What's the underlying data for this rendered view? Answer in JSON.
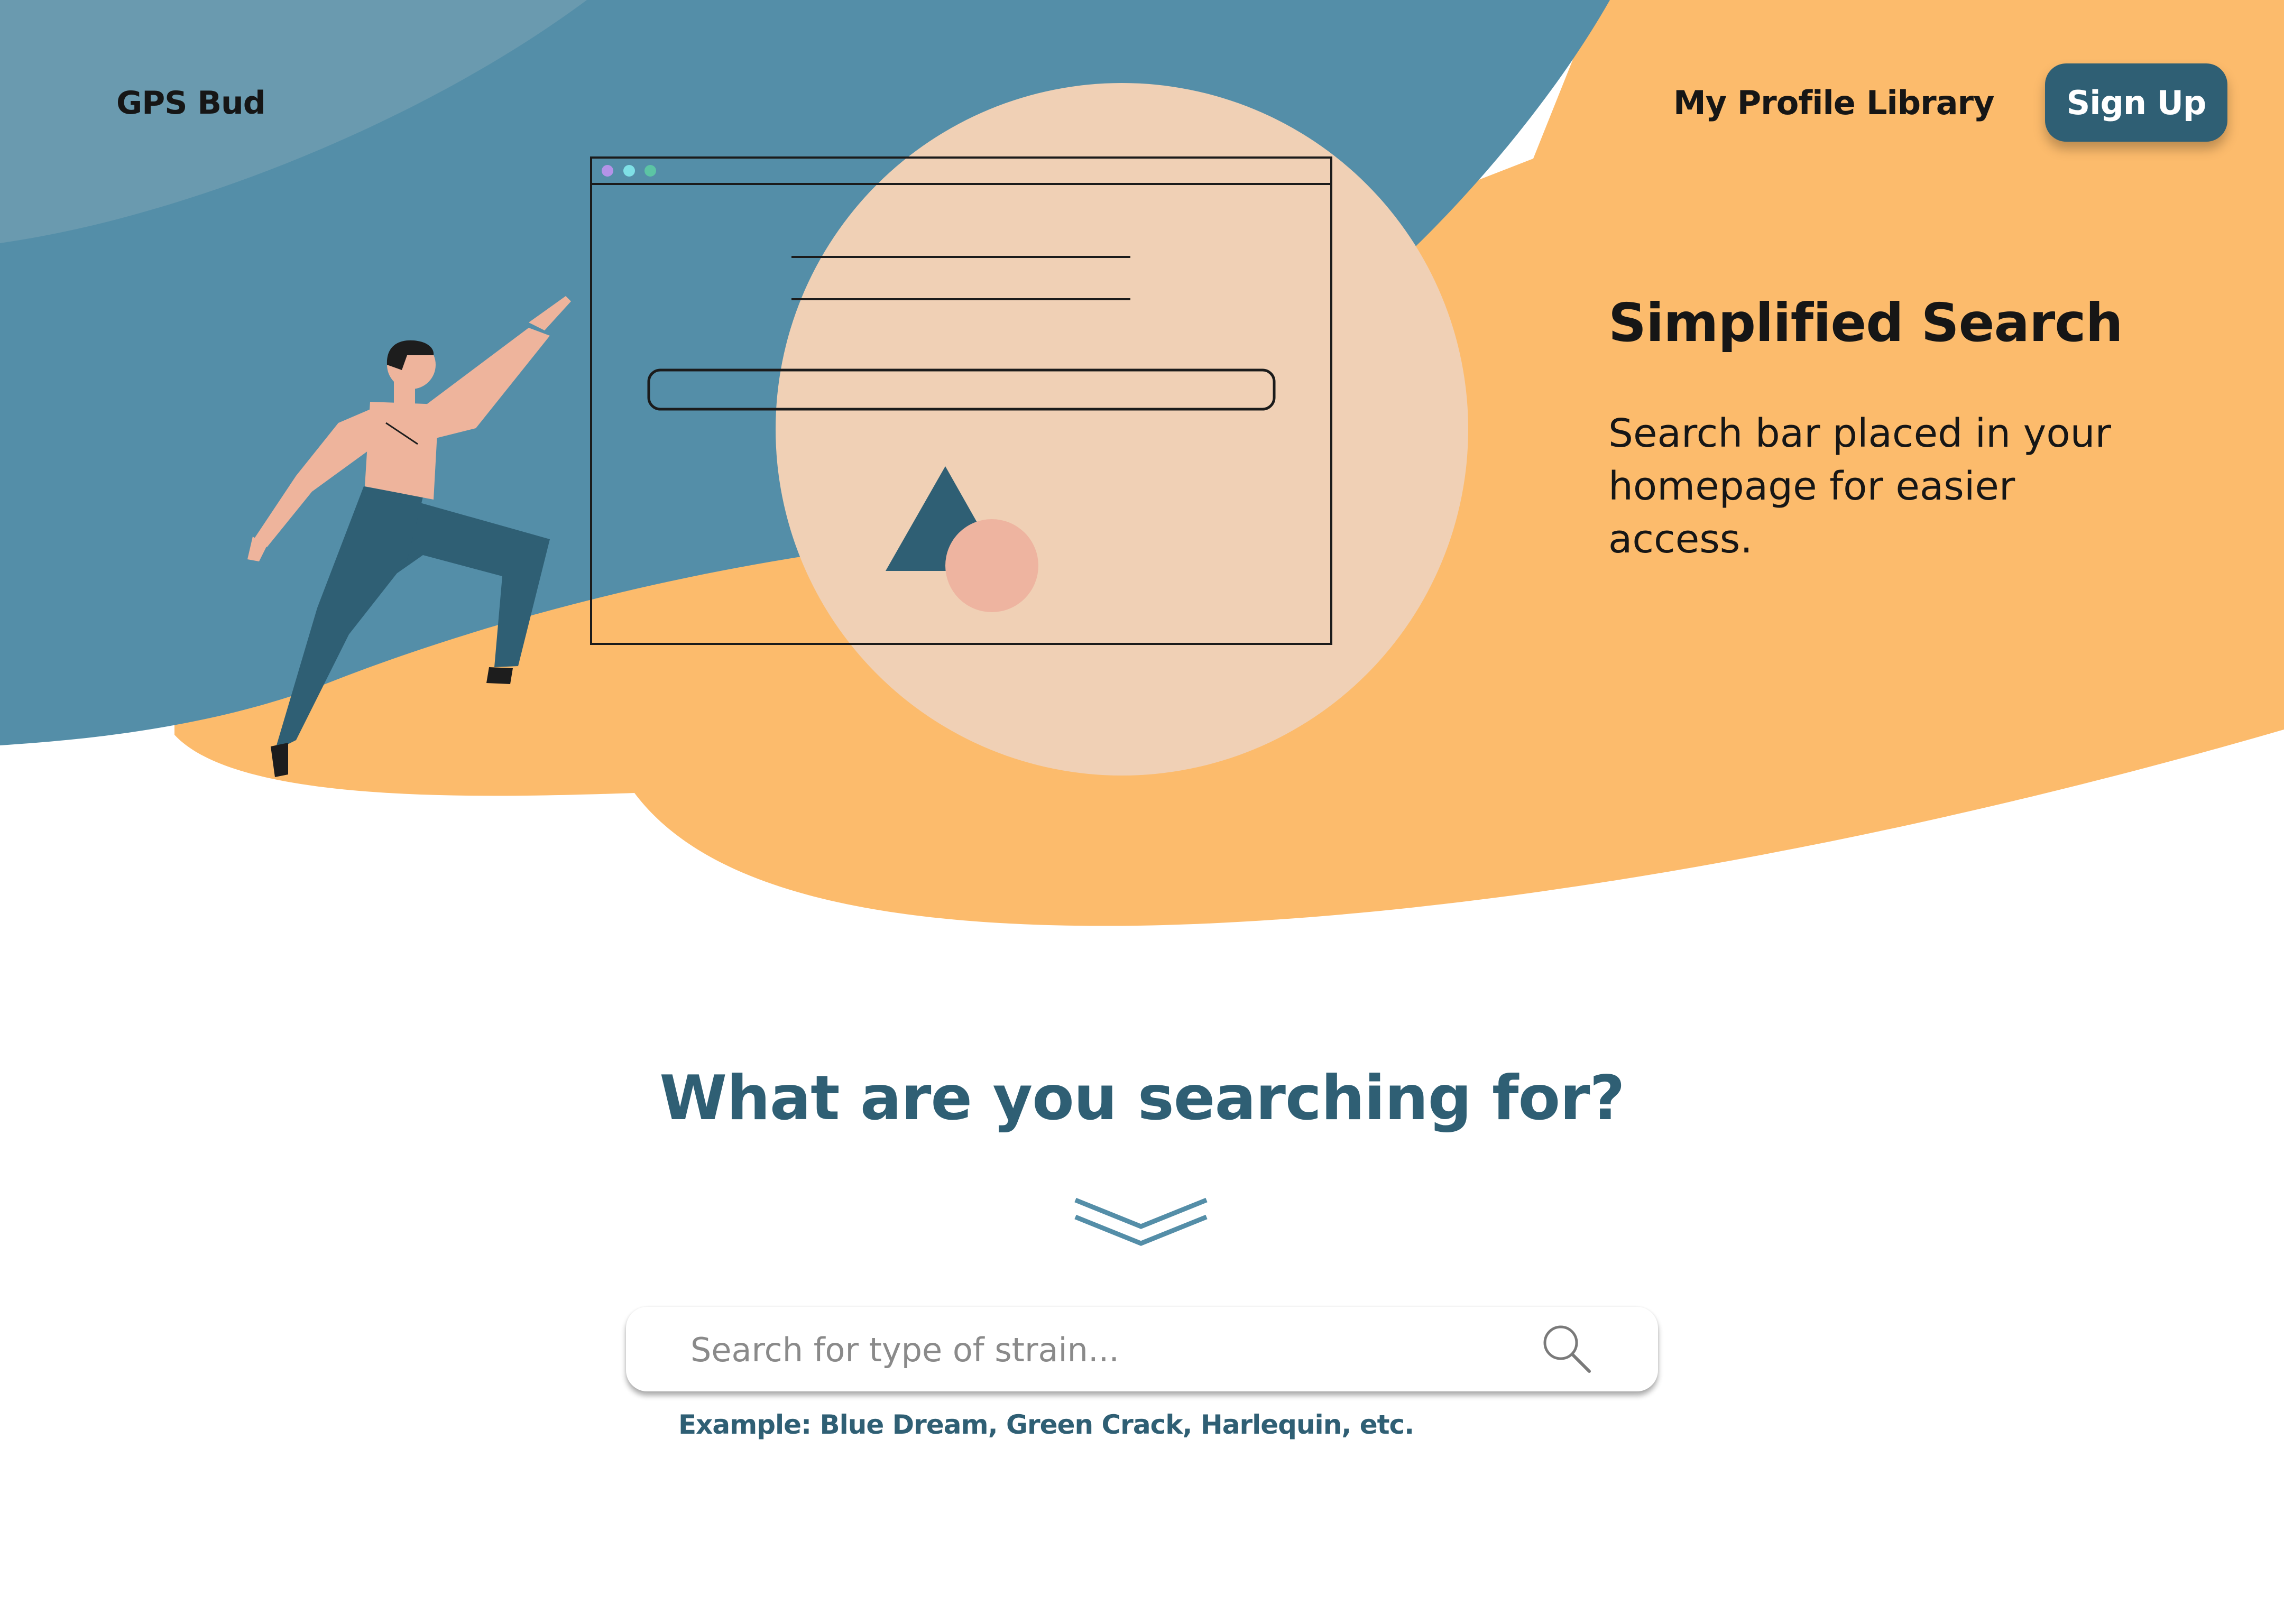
{
  "nav": {
    "logo": "GPS Bud",
    "links": [
      {
        "label": "My Profile"
      },
      {
        "label": "Library"
      }
    ],
    "signup_label": "Sign Up"
  },
  "hero": {
    "feature_title": "Simplified Search",
    "feature_description": "Search bar placed in your homepage for easier access."
  },
  "search": {
    "heading": "What are you searching for?",
    "placeholder": "Search for type of strain...",
    "value": "",
    "example": "Example: Blue Dream, Green Crack, Harlequin, etc."
  },
  "colors": {
    "teal_dark": "#2f5f74",
    "teal": "#548ea8",
    "teal_light": "#6a9aaf",
    "orange": "#fcbb6c",
    "peach_circle": "#f0d0b5",
    "pink": "#eeb4a0",
    "skin": "#eeb49c",
    "text": "#161616"
  },
  "icons": {
    "search": "magnifier-icon",
    "chevron": "double-chevron-down-icon"
  }
}
